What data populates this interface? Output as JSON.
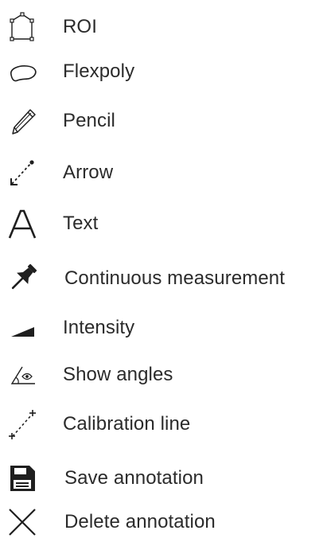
{
  "tool_menu": {
    "items": [
      {
        "id": "roi",
        "label": "ROI",
        "icon": "roi-polygon-icon"
      },
      {
        "id": "flexpoly",
        "label": "Flexpoly",
        "icon": "flexpoly-ellipse-icon"
      },
      {
        "id": "pencil",
        "label": "Pencil",
        "icon": "pencil-icon"
      },
      {
        "id": "arrow",
        "label": "Arrow",
        "icon": "arrow-icon"
      },
      {
        "id": "text",
        "label": "Text",
        "icon": "text-icon"
      },
      {
        "id": "continuous_measurement",
        "label": "Continuous measurement",
        "icon": "pushpin-icon"
      },
      {
        "id": "intensity",
        "label": "Intensity",
        "icon": "intensity-wedge-icon"
      },
      {
        "id": "show_angles",
        "label": "Show angles",
        "icon": "angle-eye-icon"
      },
      {
        "id": "calibration_line",
        "label": "Calibration line",
        "icon": "calibration-line-icon"
      },
      {
        "id": "save_annotation",
        "label": "Save annotation",
        "icon": "floppy-disk-icon"
      },
      {
        "id": "delete_annotation",
        "label": "Delete annotation",
        "icon": "close-x-icon"
      }
    ]
  },
  "colors": {
    "text": "#2b2b2b",
    "icon": "#1f1f1f"
  }
}
